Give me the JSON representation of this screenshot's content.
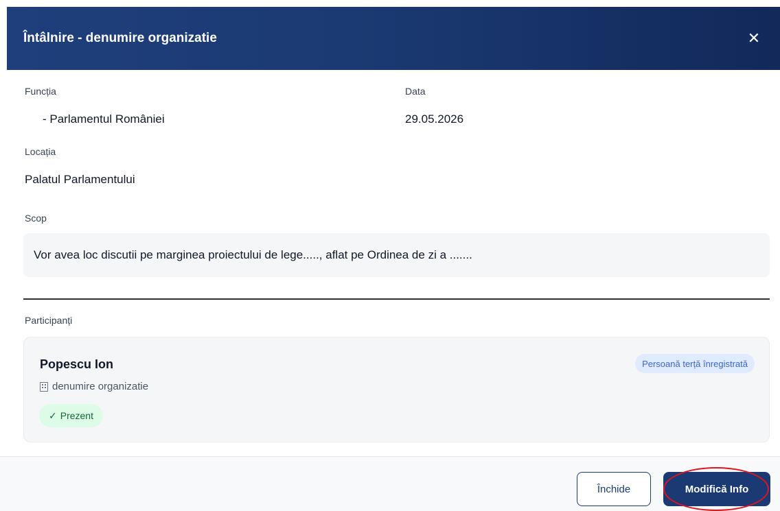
{
  "header": {
    "title": "Întâlnire - denumire organizatie",
    "close_icon": "close-icon"
  },
  "details": {
    "function_label": "Funcția",
    "function_value": "- Parlamentul României",
    "date_label": "Data",
    "date_value": "29.05.2026",
    "location_label": "Locația",
    "location_value": "Palatul Parlamentului",
    "scope_label": "Scop",
    "scope_value": "Vor avea loc discutii pe marginea proiectului de lege....., aflat pe Ordinea de zi a ......."
  },
  "participants": {
    "label": "Participanți",
    "items": [
      {
        "name": "Popescu Ion",
        "organization": "denumire organizatie",
        "organization_icon": "building-icon",
        "type_badge": "Persoană terță înregistrată",
        "status": "Prezent",
        "status_icon": "checkmark-icon"
      }
    ]
  },
  "footer": {
    "close_label": "Închide",
    "edit_label": "Modifică Info"
  },
  "colors": {
    "header_bg": "#1b3a73",
    "primary_button": "#1b3a73",
    "status_present_bg": "#dcfce7",
    "status_present_text": "#166534",
    "type_badge_bg": "#e0ebff",
    "type_badge_text": "#3b67c9",
    "highlight_ring": "#e0141e"
  }
}
